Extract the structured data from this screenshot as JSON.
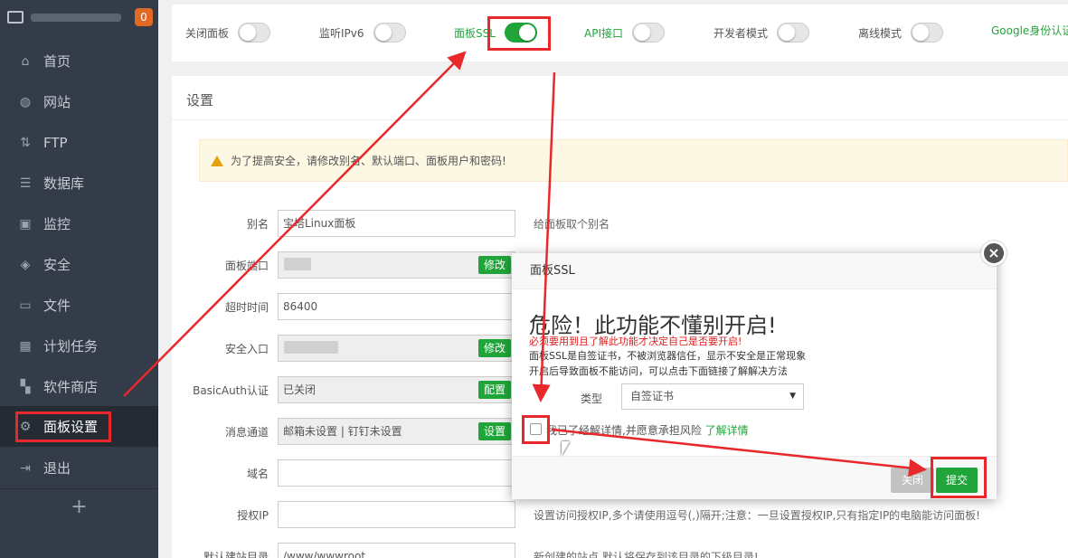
{
  "sidebar": {
    "badge": "0",
    "items": [
      {
        "label": "首页",
        "icon": "home-icon"
      },
      {
        "label": "网站",
        "icon": "globe-icon"
      },
      {
        "label": "FTP",
        "icon": "ftp-icon"
      },
      {
        "label": "数据库",
        "icon": "database-icon"
      },
      {
        "label": "监控",
        "icon": "monitor-icon"
      },
      {
        "label": "安全",
        "icon": "shield-icon"
      },
      {
        "label": "文件",
        "icon": "folder-icon"
      },
      {
        "label": "计划任务",
        "icon": "calendar-icon"
      },
      {
        "label": "软件商店",
        "icon": "apps-icon"
      },
      {
        "label": "面板设置",
        "icon": "gear-icon"
      },
      {
        "label": "退出",
        "icon": "logout-icon"
      }
    ],
    "add": "+"
  },
  "toggles": [
    {
      "label": "关闭面板",
      "on": false
    },
    {
      "label": "监听IPv6",
      "on": false
    },
    {
      "label": "面板SSL",
      "on": true
    },
    {
      "label": "API接口",
      "on": false
    },
    {
      "label": "开发者模式",
      "on": false
    },
    {
      "label": "离线模式",
      "on": false
    },
    {
      "label": "Google身份认证"
    }
  ],
  "settings": {
    "title": "设置",
    "notice": "为了提高安全，请修改别名、默认端口、面板用户和密码!",
    "rows": [
      {
        "label": "别名",
        "value": "宝塔Linux面板",
        "hint": "给面板取个别名"
      },
      {
        "label": "面板端口",
        "value": "",
        "button": "修改"
      },
      {
        "label": "超时时间",
        "value": "86400"
      },
      {
        "label": "安全入口",
        "value": "",
        "button": "修改"
      },
      {
        "label": "BasicAuth认证",
        "value": "已关闭",
        "button": "配置"
      },
      {
        "label": "消息通道",
        "value": "邮箱未设置 | 钉钉未设置",
        "button": "设置"
      },
      {
        "label": "域名",
        "value": ""
      },
      {
        "label": "授权IP",
        "value": "",
        "hint": "设置访问授权IP,多个请使用逗号(,)隔开;注意：一旦设置授权IP,只有指定IP的电脑能访问面板!"
      },
      {
        "label": "默认建站目录",
        "value": "/www/wwwroot",
        "hint": "新创建的站点,默认将保存到该目录的下级目录!"
      }
    ]
  },
  "modal": {
    "title": "面板SSL",
    "heading": "危险！此功能不懂别开启!",
    "warning": "必须要用到且了解此功能才决定自己是否要开启!",
    "line1": "面板SSL是自签证书，不被浏览器信任，显示不安全是正常现象",
    "line2": "开启后导致面板不能访问，可以点击下面链接了解解决方法",
    "type_label": "类型",
    "type_value": "自签证书",
    "checkbox_label": "我已了经解详情,并愿意承担风险",
    "learn_more": "了解详情",
    "close_label": "关闭",
    "submit_label": "提交"
  }
}
